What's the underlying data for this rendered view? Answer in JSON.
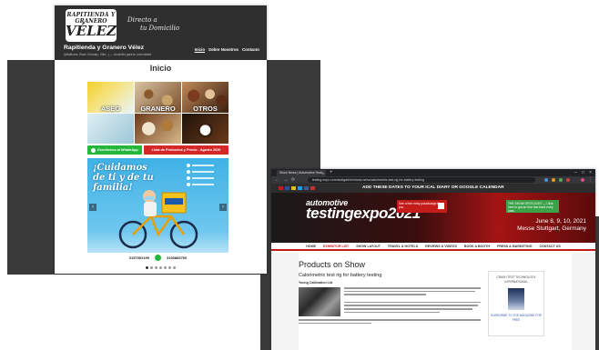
{
  "site1": {
    "logo": {
      "line1": "RAPITIENDA Y",
      "line2": "GRANERO",
      "line3": "VÉLEZ"
    },
    "tagline": [
      "Directo a",
      "tu Domicilio"
    ],
    "title": "Rapitienda y Granero Vélez",
    "subtitle": "(Miraflores, Buen Consejo, Villa...) — domicilio para tu comodidad",
    "nav": [
      "Inicio",
      "Sobre Nosotros",
      "Contacto"
    ],
    "page_title": "Inicio",
    "tiles": [
      "ASEO",
      "GRANERO",
      "OTROS"
    ],
    "whatsapp_label": "Escríbenos al WhatsApp",
    "price_list_label": "Lista de Productos y Precio - Agosto 2020",
    "banner": {
      "headline": "¡Cuidamos de ti y de tu familia!",
      "phones": [
        "3157902199",
        "3193883760"
      ],
      "slide_count": 7
    }
  },
  "site2": {
    "tab_title": "Show News | Automotive Testi...",
    "url": "testing-expo.com/stuttgart/en/show-news/calorimetric-test-rig-for-battery-testing",
    "promo": "ADD THESE DATES TO YOUR ICAL DIARY OR GOOGLE CALENDAR",
    "hero": {
      "line1": "automotive",
      "line2": "testing",
      "line3": "expo",
      "year": "2021",
      "dates": "June 8, 9, 10, 2021",
      "venue": "Messe Stuttgart, Germany",
      "red_card": "See a free entry pass/badge for you",
      "green_card": "THE SHOW SPOTLIGHT — Click here to get an free fast track entry pass"
    },
    "nav": [
      "HOME",
      "EXHIBITOR LIST",
      "SHOW LAYOUT",
      "TRAVEL & HOTELS",
      "REVIEWS & VIDEOS",
      "BOOK A BOOTH",
      "PRESS & MARKETING",
      "CONTACT US"
    ],
    "nav_active": 1,
    "section_title": "Products on Show",
    "product_title": "Calorimetric test rig for battery testing",
    "product_company": "Young Calibration Ltd",
    "ad_title": "CRASH TEST TECHNOLOGY INTERNATIONAL",
    "ad_subscribe": "SUBSCRIBE TO THE MAGAZINE FOR FREE"
  },
  "colors": {
    "dark_header": "#2f2f2f",
    "whatsapp_green": "#25b63c",
    "price_red": "#d42828",
    "banner_blue": "#3fb2e6",
    "expo_red": "#c41b1b"
  }
}
